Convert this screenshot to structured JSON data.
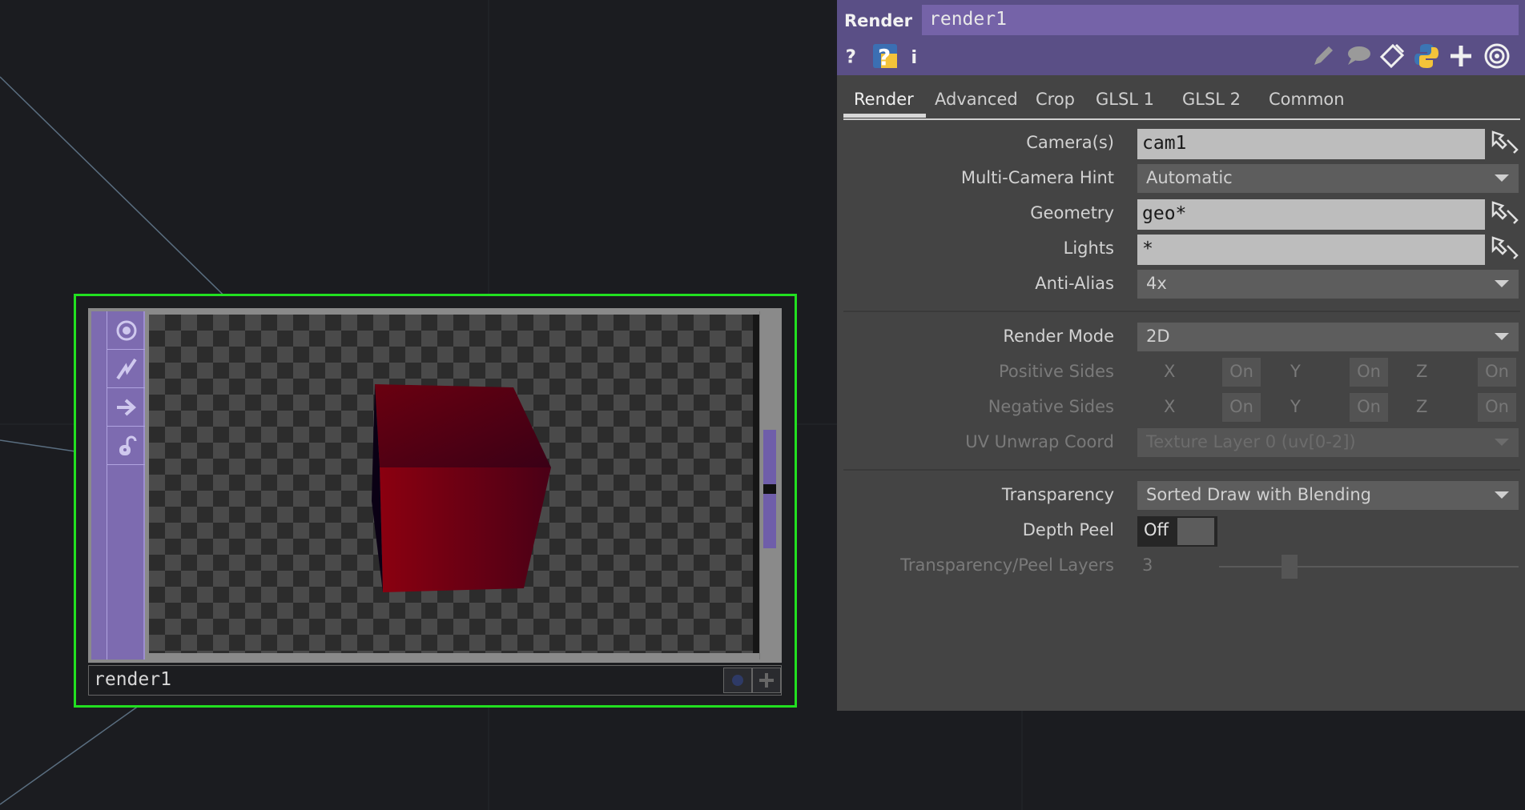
{
  "node": {
    "name": "render1",
    "side_buttons": [
      "viewer-toggle-icon",
      "cook-icon",
      "bypass-arrow-icon",
      "lock-icon"
    ]
  },
  "panel": {
    "op_type": "Render",
    "op_name": "render1",
    "header_icons": [
      "help-icon",
      "python-help-icon",
      "info-icon",
      "edit-icon",
      "comment-icon",
      "clone-icon",
      "python-icon",
      "add-icon",
      "viewer-icon"
    ],
    "tabs": [
      "Render",
      "Advanced",
      "Crop",
      "GLSL 1",
      "GLSL 2",
      "Common"
    ],
    "active_tab": "Render",
    "params": {
      "cameras": {
        "label": "Camera(s)",
        "value": "cam1"
      },
      "multi_camera_hint": {
        "label": "Multi-Camera Hint",
        "value": "Automatic"
      },
      "geometry": {
        "label": "Geometry",
        "value": "geo*"
      },
      "lights": {
        "label": "Lights",
        "value": "*"
      },
      "anti_alias": {
        "label": "Anti-Alias",
        "value": "4x"
      },
      "render_mode": {
        "label": "Render Mode",
        "value": "2D"
      },
      "positive_sides": {
        "label": "Positive Sides",
        "x": "X",
        "y": "Y",
        "z": "Z",
        "x_val": "On",
        "y_val": "On",
        "z_val": "On"
      },
      "negative_sides": {
        "label": "Negative Sides",
        "x": "X",
        "y": "Y",
        "z": "Z",
        "x_val": "On",
        "y_val": "On",
        "z_val": "On"
      },
      "uv_unwrap": {
        "label": "UV Unwrap Coord",
        "value": "Texture Layer 0 (uv[0-2])"
      },
      "transparency": {
        "label": "Transparency",
        "value": "Sorted Draw with Blending"
      },
      "depth_peel": {
        "label": "Depth Peel",
        "value": "Off"
      },
      "peel_layers": {
        "label": "Transparency/Peel Layers",
        "value": "3"
      }
    }
  },
  "colors": {
    "node_selected_border": "#22e020",
    "header_purple": "#5a4f86",
    "cube_red": "#8b0010"
  }
}
